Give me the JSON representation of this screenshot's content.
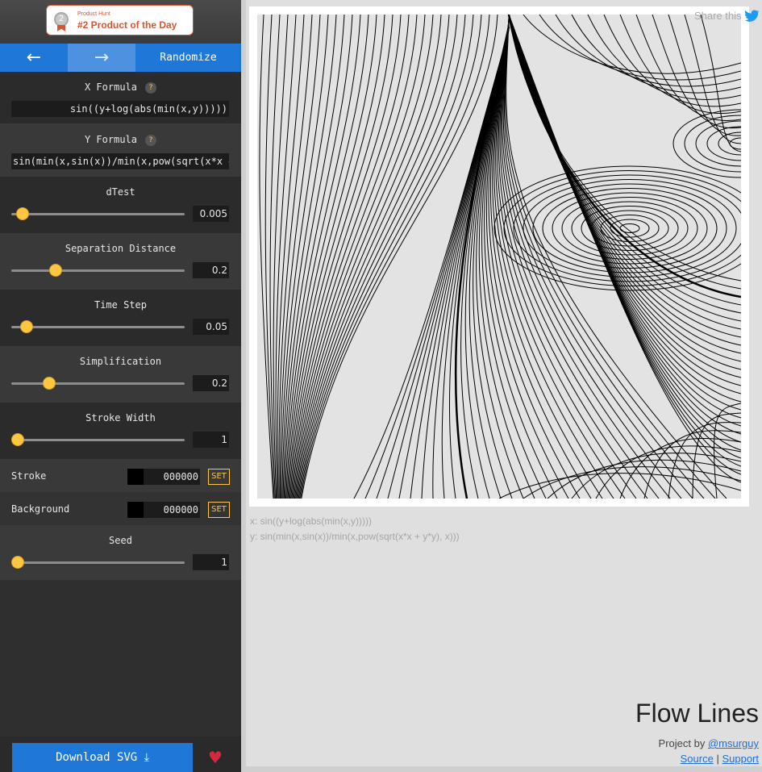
{
  "product_hunt": {
    "small": "Product Hunt",
    "big": "#2 Product of the Day",
    "medal": "2"
  },
  "nav": {
    "prev_icon": "←",
    "next_icon": "→",
    "randomize": "Randomize"
  },
  "x_formula": {
    "label": "X Formula",
    "help": "?",
    "value": "sin((y+log(abs(min(x,y)))))"
  },
  "y_formula": {
    "label": "Y Formula",
    "help": "?",
    "value": "sin(min(x,sin(x))/min(x,pow(sqrt(x*x + y*"
  },
  "sliders": [
    {
      "label": "dTest",
      "value": "0.005",
      "level": 0.03
    },
    {
      "label": "Separation Distance",
      "value": "0.2",
      "level": 0.22
    },
    {
      "label": "Time Step",
      "value": "0.05",
      "level": 0.05
    },
    {
      "label": "Simplification",
      "value": "0.2",
      "level": 0.18
    },
    {
      "label": "Stroke Width",
      "value": "1",
      "level": 0.0
    }
  ],
  "colors": [
    {
      "label": "Stroke",
      "value": "000000",
      "set": "SET"
    },
    {
      "label": "Background",
      "value": "000000",
      "set": "SET"
    }
  ],
  "seed": {
    "label": "Seed",
    "value": "1",
    "level": 0.0
  },
  "download": {
    "label": "Download SVG",
    "icon": "⤓"
  },
  "heart_icon": "♥",
  "share": {
    "label": "Share this",
    "icon": "twitter-icon"
  },
  "formula_display": {
    "x": "x: sin((y+log(abs(min(x,y)))))",
    "y": "y: sin(min(x,sin(x))/min(x,pow(sqrt(x*x + y*y), x)))"
  },
  "title": "Flow Lines",
  "credit": {
    "prefix": "Project by ",
    "author": "@msurguy",
    "source": "Source",
    "sep": " | ",
    "support": "Support"
  },
  "accent": "#1f78d8",
  "thumb_color": "#ffc640"
}
